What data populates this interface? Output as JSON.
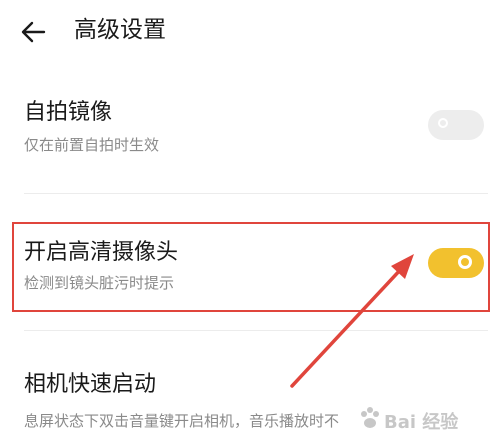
{
  "header": {
    "back_icon": "arrow-left-icon",
    "title": "高级设置"
  },
  "settings": [
    {
      "title": "自拍镜像",
      "description": "仅在前置自拍时生效",
      "enabled": false
    },
    {
      "title": "开启高清摄像头",
      "description": "检测到镜头脏污时提示",
      "enabled": true
    },
    {
      "title": "相机快速启动",
      "description": "息屏状态下双击音量键开启相机，音乐播放时不",
      "enabled": null
    }
  ],
  "colors": {
    "toggle_on": "#f2c12e",
    "toggle_off": "#ededed",
    "annotation": "#e0453c"
  },
  "watermark": {
    "text": "Bai 经验",
    "icon": "paw-icon"
  }
}
